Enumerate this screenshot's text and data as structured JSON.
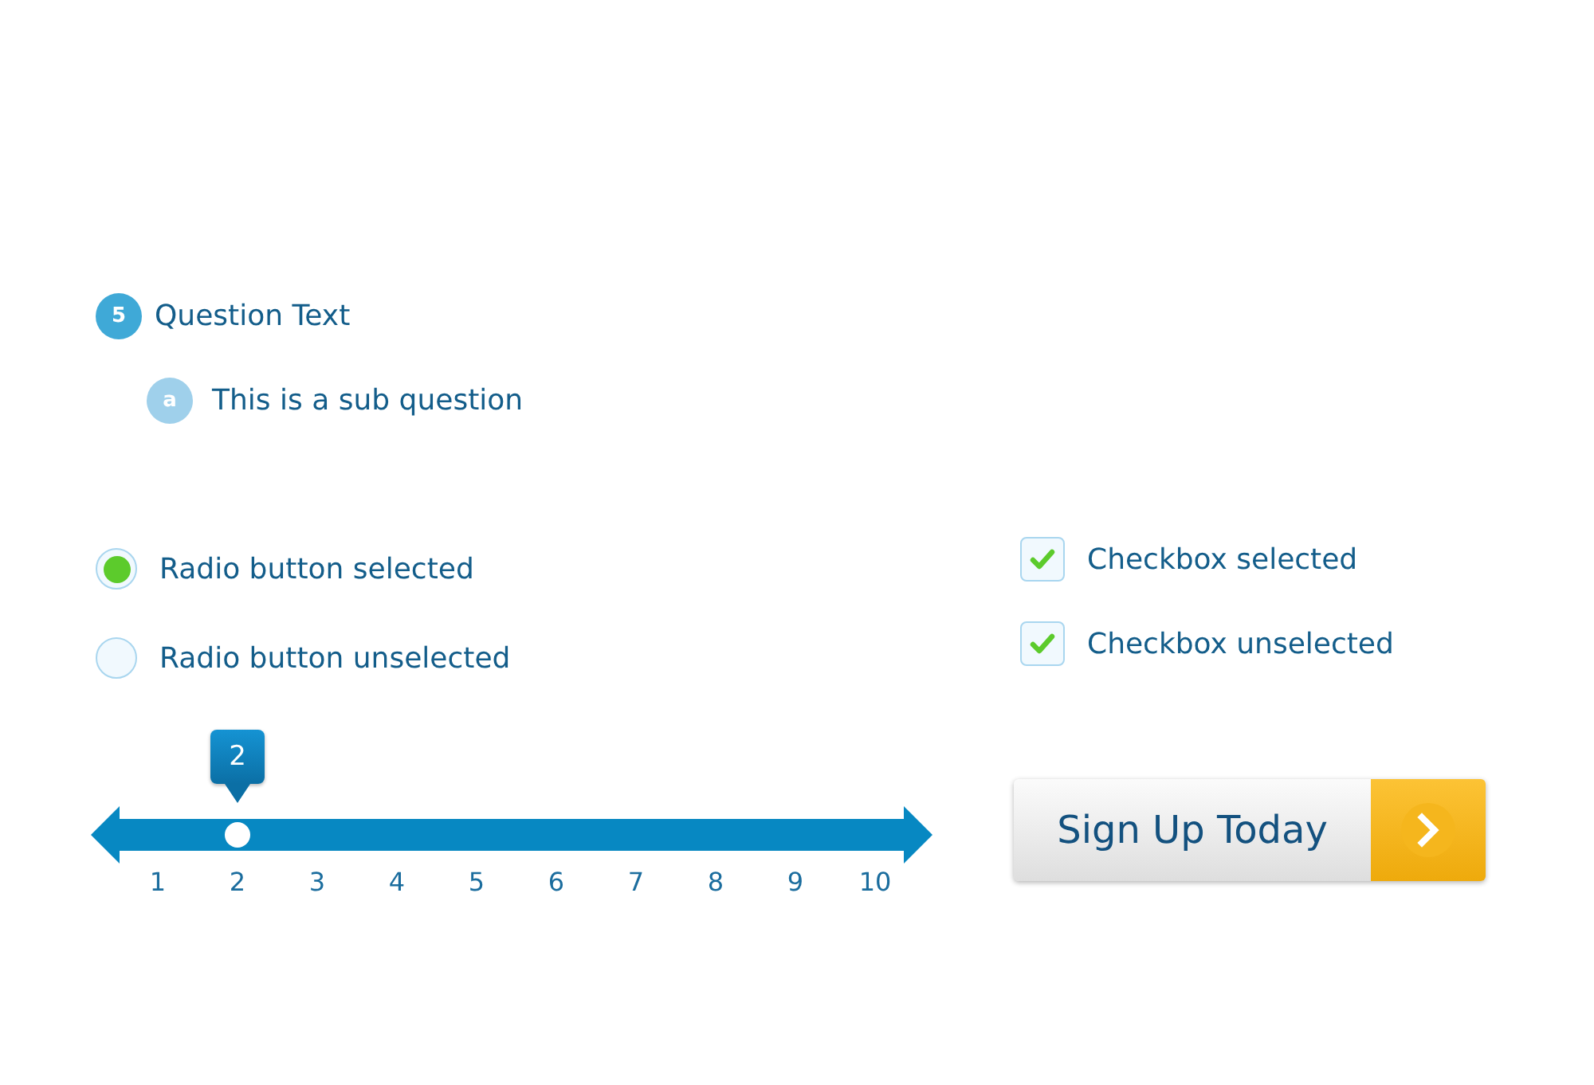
{
  "question": {
    "number": "5",
    "text": "Question Text"
  },
  "sub_question": {
    "letter": "a",
    "text": "This is a sub question"
  },
  "radios": [
    {
      "label": "Radio button selected",
      "selected": true
    },
    {
      "label": "Radio button unselected",
      "selected": false
    }
  ],
  "checkboxes": [
    {
      "label": "Checkbox selected",
      "checked": true
    },
    {
      "label": "Checkbox unselected",
      "checked": true
    }
  ],
  "number_line": {
    "marker": "2",
    "ticks": [
      {
        "label": "1",
        "selected": false
      },
      {
        "label": "2",
        "selected": true
      },
      {
        "label": "3",
        "selected": false
      },
      {
        "label": "4",
        "selected": false
      },
      {
        "label": "5",
        "selected": false
      },
      {
        "label": "6",
        "selected": false
      },
      {
        "label": "7",
        "selected": false
      },
      {
        "label": "8",
        "selected": false
      },
      {
        "label": "9",
        "selected": false
      },
      {
        "label": "10",
        "selected": false
      }
    ]
  },
  "signup_button": {
    "label": "Sign Up Today"
  }
}
